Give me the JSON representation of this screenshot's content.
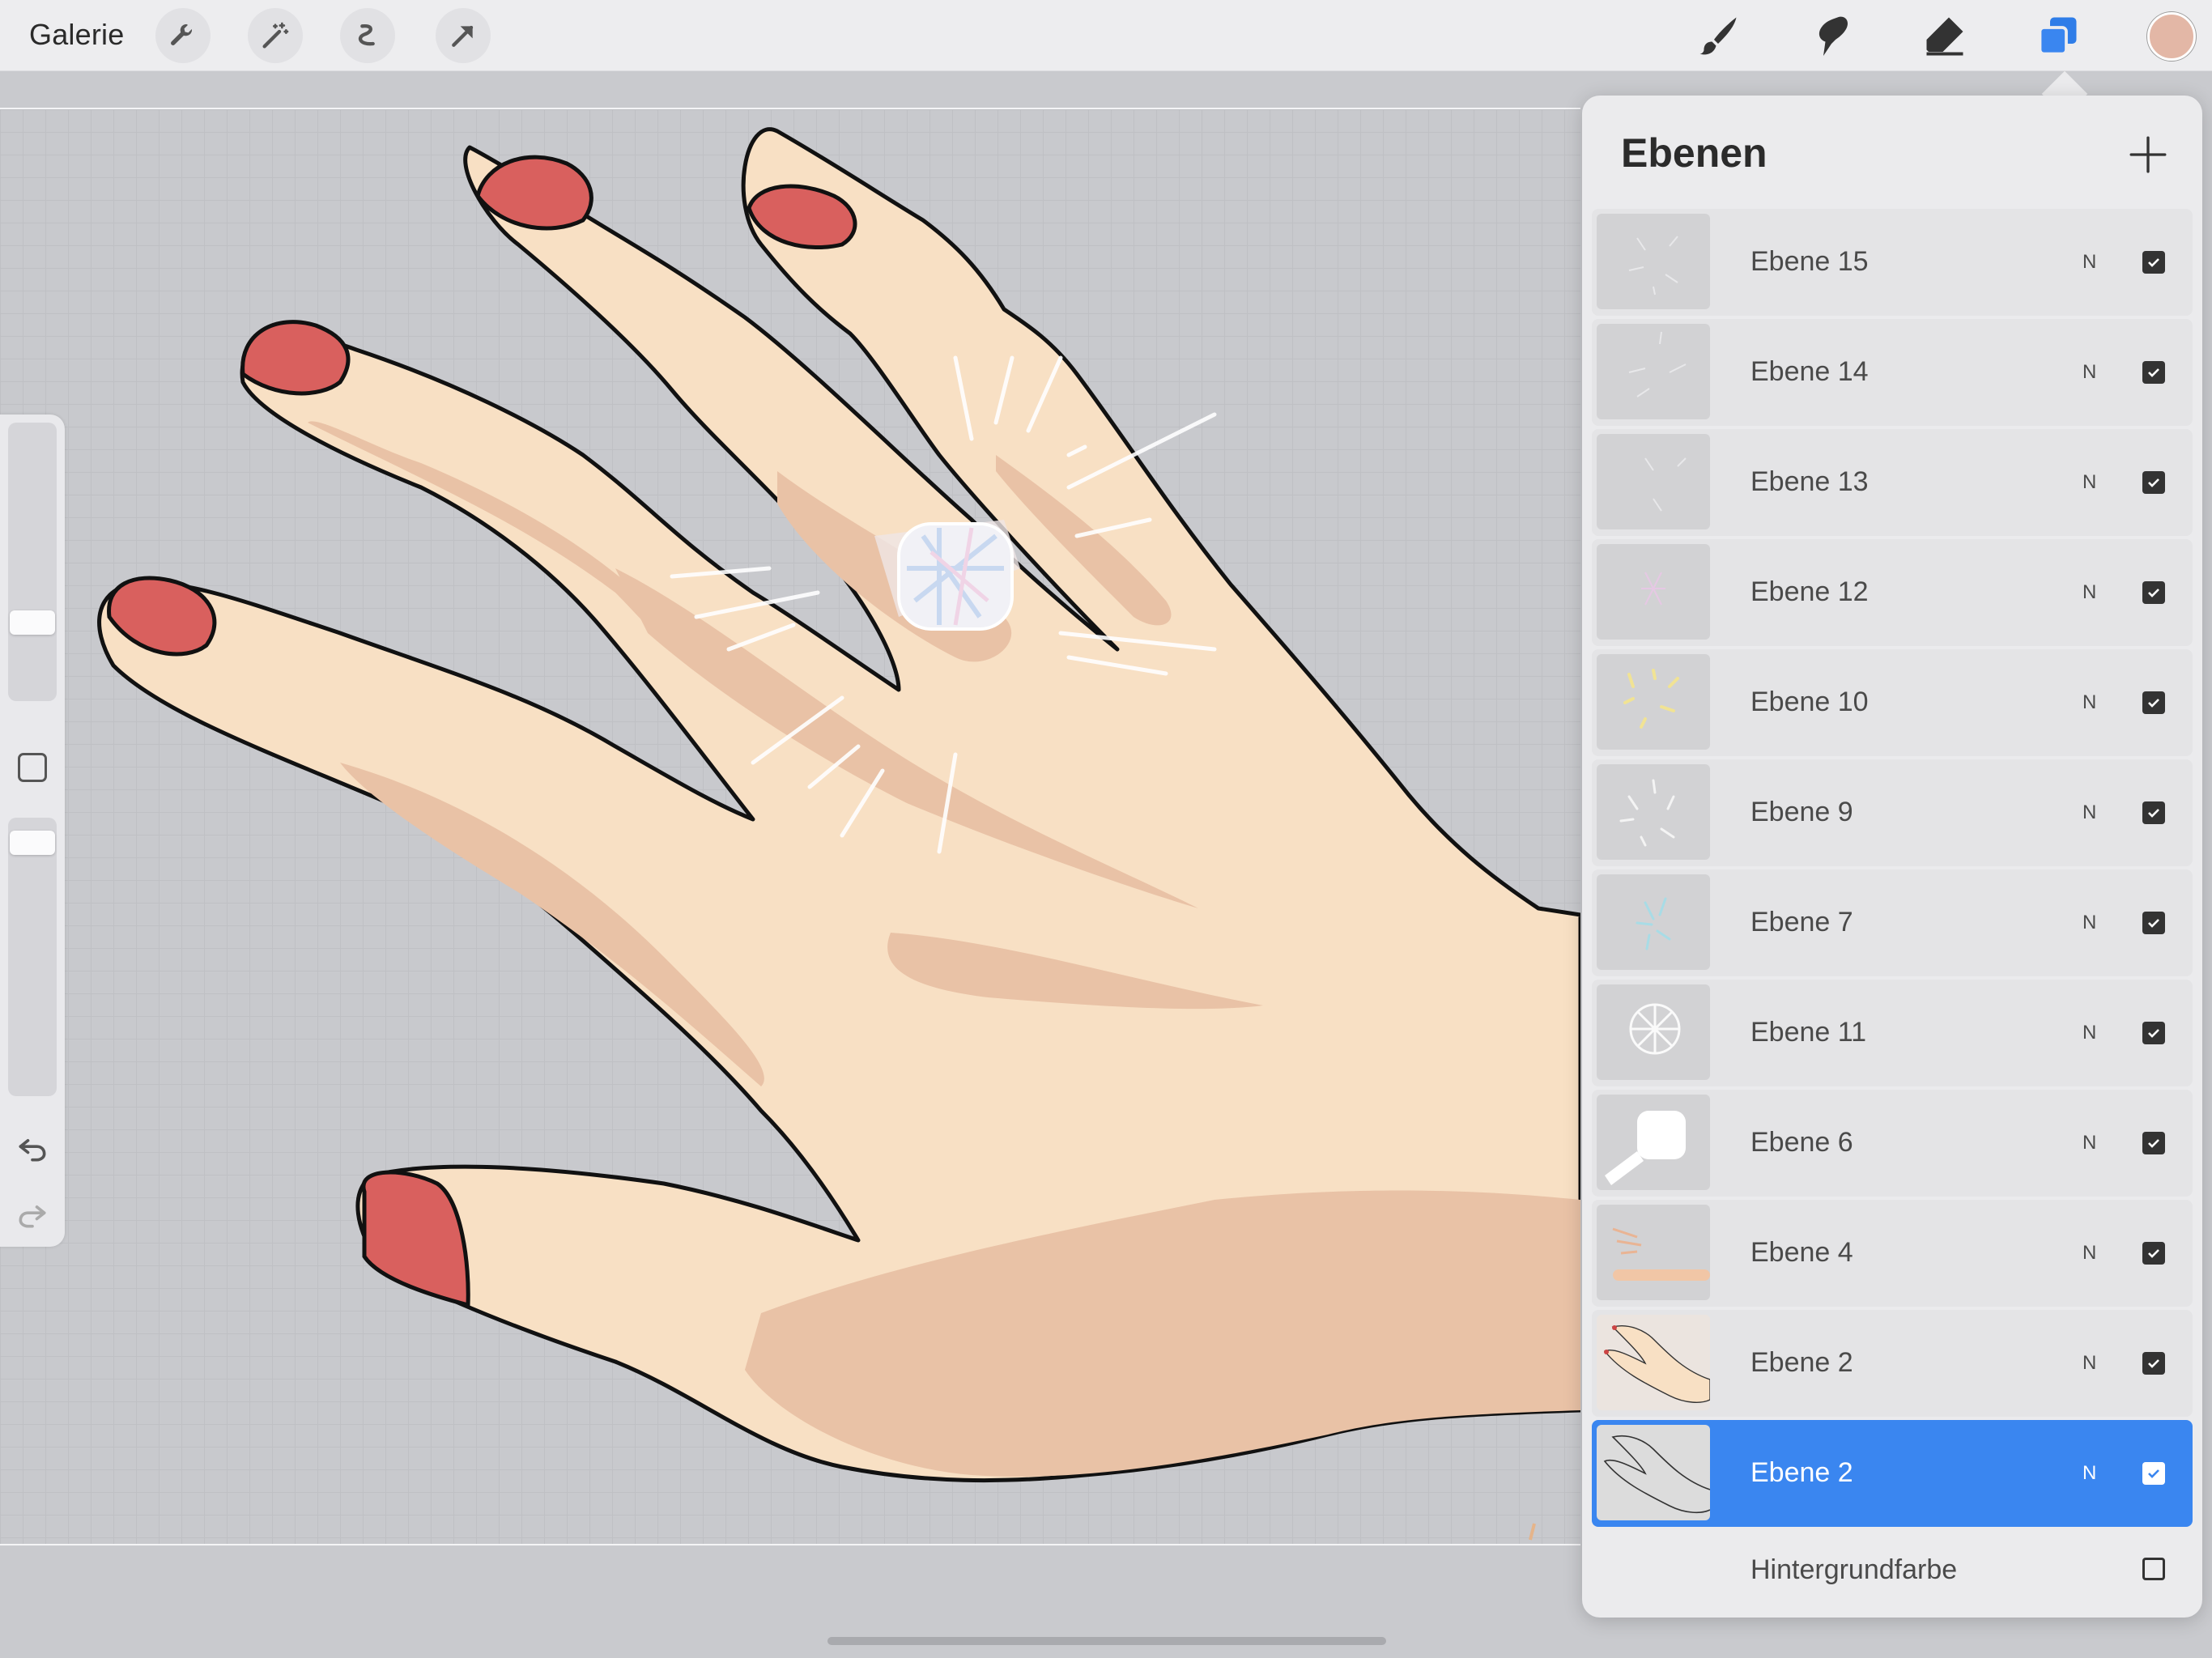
{
  "topbar": {
    "gallery_label": "Galerie",
    "tools_left": [
      {
        "icon": "wrench-icon",
        "name": "Aktionen"
      },
      {
        "icon": "magic-wand-icon",
        "name": "Anpassungen"
      },
      {
        "icon": "selection-icon",
        "name": "Auswahl"
      },
      {
        "icon": "transform-arrow-icon",
        "name": "Transformieren"
      }
    ],
    "tools_right": [
      {
        "icon": "brush-icon",
        "name": "Malen"
      },
      {
        "icon": "smudge-icon",
        "name": "Verwischen"
      },
      {
        "icon": "eraser-icon",
        "name": "Radieren"
      },
      {
        "icon": "layers-icon",
        "name": "Ebenen",
        "active": true
      }
    ],
    "current_color": "#e3b7a6",
    "accent_color": "#3a86f0"
  },
  "sidebar": {
    "brush_size_level": 0.26,
    "opacity_level": 0.95,
    "icons": [
      "modify-square-icon",
      "undo-icon",
      "redo-icon"
    ]
  },
  "layers_panel": {
    "title": "Ebenen",
    "add_icon": "plus-icon",
    "layers": [
      {
        "name": "Ebene 15",
        "mode": "N",
        "visible": true,
        "selected": false
      },
      {
        "name": "Ebene 14",
        "mode": "N",
        "visible": true,
        "selected": false
      },
      {
        "name": "Ebene 13",
        "mode": "N",
        "visible": true,
        "selected": false
      },
      {
        "name": "Ebene 12",
        "mode": "N",
        "visible": true,
        "selected": false
      },
      {
        "name": "Ebene 10",
        "mode": "N",
        "visible": true,
        "selected": false
      },
      {
        "name": "Ebene 9",
        "mode": "N",
        "visible": true,
        "selected": false
      },
      {
        "name": "Ebene 7",
        "mode": "N",
        "visible": true,
        "selected": false
      },
      {
        "name": "Ebene 11",
        "mode": "N",
        "visible": true,
        "selected": false
      },
      {
        "name": "Ebene 6",
        "mode": "N",
        "visible": true,
        "selected": false
      },
      {
        "name": "Ebene 4",
        "mode": "N",
        "visible": true,
        "selected": false
      },
      {
        "name": "Ebene 2",
        "mode": "N",
        "visible": true,
        "selected": false
      },
      {
        "name": "Ebene 2",
        "mode": "N",
        "visible": true,
        "selected": true
      }
    ],
    "background": {
      "name": "Hintergrundfarbe",
      "visible": false
    }
  },
  "artwork": {
    "skin_color": "#f8e0c4",
    "shadow_color": "#e9c2a6",
    "nail_color": "#d9605e"
  }
}
